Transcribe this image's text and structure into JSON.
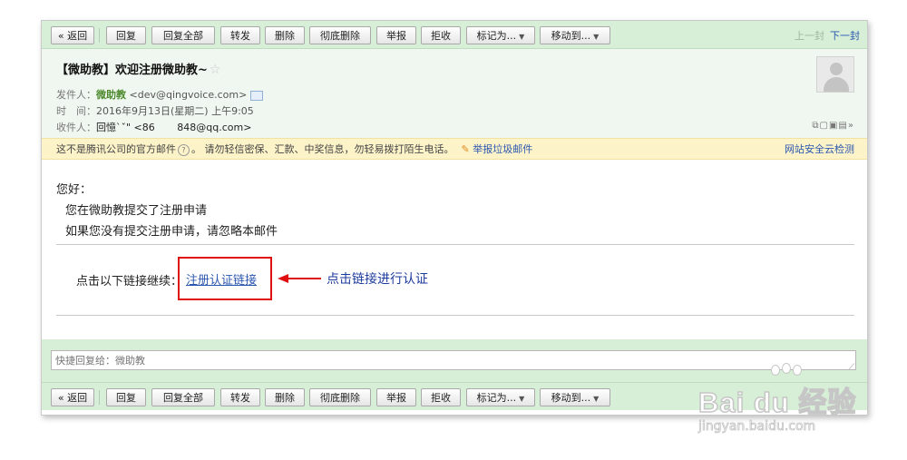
{
  "toolbar": {
    "back": "« 返回",
    "reply": "回复",
    "reply_all": "回复全部",
    "forward": "转发",
    "delete": "删除",
    "delete_perm": "彻底删除",
    "report": "举报",
    "reject": "拒收",
    "mark_as": "标记为...",
    "move_to": "移动到...",
    "prev": "上一封",
    "next": "下一封"
  },
  "email": {
    "subject": "【微助教】欢迎注册微助教~",
    "sender_label": "发件人：",
    "sender_name": "微助教",
    "sender_email": "<dev@qingvoice.com>",
    "time_label": "时　间：",
    "time_value": "2016年9月13日(星期二) 上午9:05",
    "recipient_label": "收件人：",
    "recipient_value": "回憶`ˇ\" <86       848@qq.com>"
  },
  "warning": {
    "text_a": "这不是腾讯公司的官方邮件",
    "text_b": "。 请勿轻信密保、汇款、中奖信息，勿轻易拨打陌生电话。",
    "report_spam": "举报垃圾邮件",
    "security_check": "网站安全云检测"
  },
  "body": {
    "greeting": "您好：",
    "line1": "您在微助教提交了注册申请",
    "line2": "如果您没有提交注册申请，请忽略本邮件",
    "link_prompt": "点击以下链接继续：",
    "link_text": "注册认证链接",
    "annotation": "点击链接进行认证"
  },
  "reply_box": {
    "placeholder": "快捷回复给：微助教"
  },
  "watermark": {
    "logo": "Bai du 经验",
    "url": "jingyan.baidu.com"
  },
  "colors": {
    "toolbar_bg": "#d7eed7",
    "link": "#2b57b0",
    "highlight_box": "#e01010",
    "annotation_text": "#1d3b9c",
    "warning_bg": "#fdf3c9"
  }
}
